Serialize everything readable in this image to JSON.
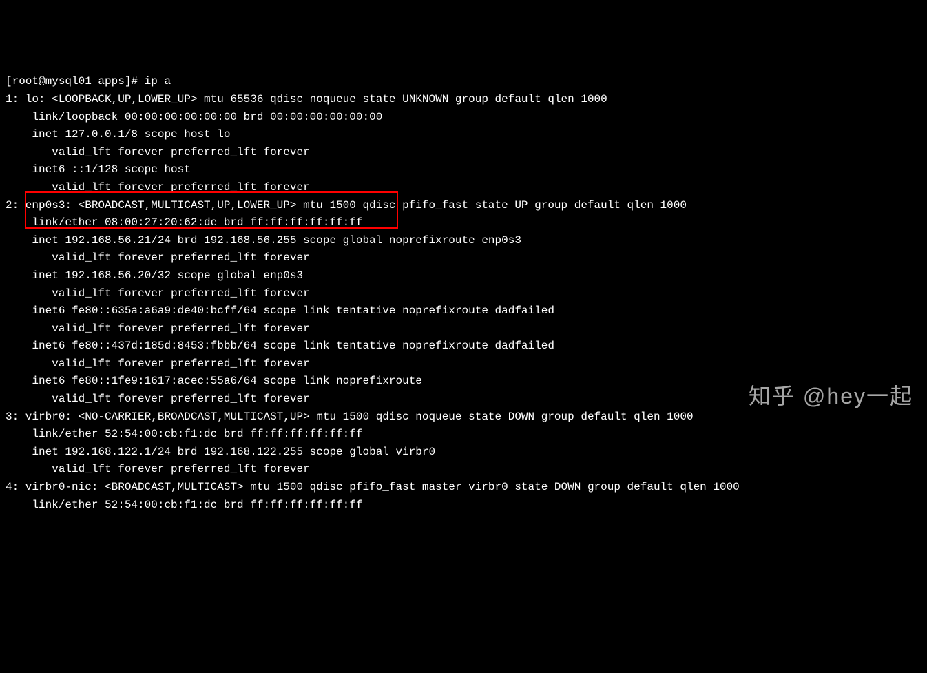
{
  "terminal": {
    "lines": [
      "[root@mysql01 apps]# ip a",
      "1: lo: <LOOPBACK,UP,LOWER_UP> mtu 65536 qdisc noqueue state UNKNOWN group default qlen 1000",
      "    link/loopback 00:00:00:00:00:00 brd 00:00:00:00:00:00",
      "    inet 127.0.0.1/8 scope host lo",
      "       valid_lft forever preferred_lft forever",
      "    inet6 ::1/128 scope host",
      "       valid_lft forever preferred_lft forever",
      "2: enp0s3: <BROADCAST,MULTICAST,UP,LOWER_UP> mtu 1500 qdisc pfifo_fast state UP group default qlen 1000",
      "    link/ether 08:00:27:20:62:de brd ff:ff:ff:ff:ff:ff",
      "    inet 192.168.56.21/24 brd 192.168.56.255 scope global noprefixroute enp0s3",
      "       valid_lft forever preferred_lft forever",
      "    inet 192.168.56.20/32 scope global enp0s3",
      "       valid_lft forever preferred_lft forever",
      "    inet6 fe80::635a:a6a9:de40:bcff/64 scope link tentative noprefixroute dadfailed",
      "       valid_lft forever preferred_lft forever",
      "    inet6 fe80::437d:185d:8453:fbbb/64 scope link tentative noprefixroute dadfailed",
      "       valid_lft forever preferred_lft forever",
      "    inet6 fe80::1fe9:1617:acec:55a6/64 scope link noprefixroute",
      "       valid_lft forever preferred_lft forever",
      "3: virbr0: <NO-CARRIER,BROADCAST,MULTICAST,UP> mtu 1500 qdisc noqueue state DOWN group default qlen 1000",
      "    link/ether 52:54:00:cb:f1:dc brd ff:ff:ff:ff:ff:ff",
      "    inet 192.168.122.1/24 brd 192.168.122.255 scope global virbr0",
      "       valid_lft forever preferred_lft forever",
      "4: virbr0-nic: <BROADCAST,MULTICAST> mtu 1500 qdisc pfifo_fast master virbr0 state DOWN group default qlen 1000",
      "    link/ether 52:54:00:cb:f1:dc brd ff:ff:ff:ff:ff:ff"
    ]
  },
  "watermark": "知乎 @hey一起"
}
